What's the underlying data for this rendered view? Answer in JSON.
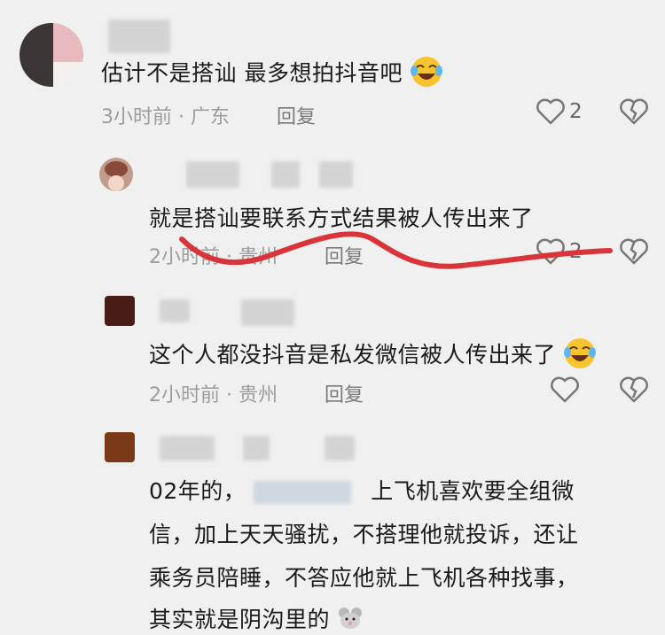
{
  "comments": [
    {
      "text": "估计不是搭讪  最多想拍抖音吧",
      "time": "3小时前 · 广东",
      "reply_label": "回复",
      "like_count": "2",
      "emoji": "laughing-crying-emoji"
    },
    {
      "text": "就是搭讪要联系方式结果被人传出来了",
      "time": "2小时前 · 贵州",
      "reply_label": "回复",
      "like_count": "2"
    },
    {
      "text": "这个人都没抖音是私发微信被人传出来了",
      "time": "2小时前 · 贵州",
      "reply_label": "回复",
      "emoji": "laughing-crying-emoji"
    },
    {
      "lines": [
        "02年的，",
        "上飞机喜欢要全组微",
        "信，加上天天骚扰，不搭理他就投诉，还让",
        "乘务员陪睡，不答应他就上飞机各种找事，",
        "其实就是阴沟里的"
      ],
      "emoji": "rat-emoji"
    }
  ],
  "colors": {
    "background": "#f0f0f0",
    "annotation_stroke": "#d8343a",
    "meta_text": "#9c9c9c"
  }
}
